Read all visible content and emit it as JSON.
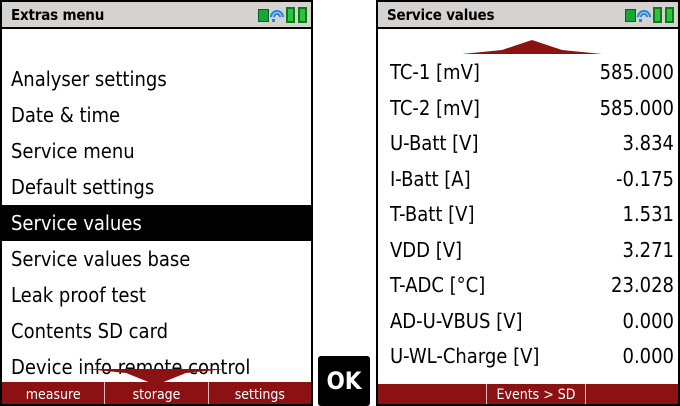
{
  "left_screen": {
    "title": "Extras menu",
    "menu_items": [
      {
        "label": "Analyser settings"
      },
      {
        "label": "Date & time"
      },
      {
        "label": "Service menu"
      },
      {
        "label": "Default settings"
      },
      {
        "label": "Service values"
      },
      {
        "label": "Service values base"
      },
      {
        "label": "Leak proof test"
      },
      {
        "label": "Contents SD card"
      },
      {
        "label": "Device info remote control"
      }
    ],
    "selected_item": "Service values",
    "softkeys": [
      "measure",
      "storage",
      "settings"
    ]
  },
  "ok_key": {
    "label": "OK"
  },
  "right_screen": {
    "title": "Service values",
    "rows": [
      {
        "label": "TC-1 [mV]",
        "value": "585.000"
      },
      {
        "label": "TC-2 [mV]",
        "value": "585.000"
      },
      {
        "label": "U-Batt [V]",
        "value": "3.834"
      },
      {
        "label": "I-Batt [A]",
        "value": "-0.175"
      },
      {
        "label": "T-Batt [V]",
        "value": "1.531"
      },
      {
        "label": "VDD [V]",
        "value": "3.271"
      },
      {
        "label": "T-ADC [°C]",
        "value": "23.028"
      },
      {
        "label": "AD-U-VBUS [V]",
        "value": "0.000"
      },
      {
        "label": "U-WL-Charge [V]",
        "value": "0.000"
      }
    ],
    "softkey_events": "Events > SD"
  },
  "icons": {
    "status": [
      "status-square-icon",
      "wifi-icon",
      "battery-icon",
      "battery-icon"
    ],
    "scroll": [
      "scroll-up-arrow-icon",
      "scroll-down-arrow-icon"
    ]
  },
  "colors": {
    "titlebar_bg": "#d6d2cf",
    "softkey_bar_bg": "#8b1113",
    "selection_bg": "#000000",
    "battery_green": "#2fc23c",
    "wifi_blue": "#1e88e5"
  }
}
